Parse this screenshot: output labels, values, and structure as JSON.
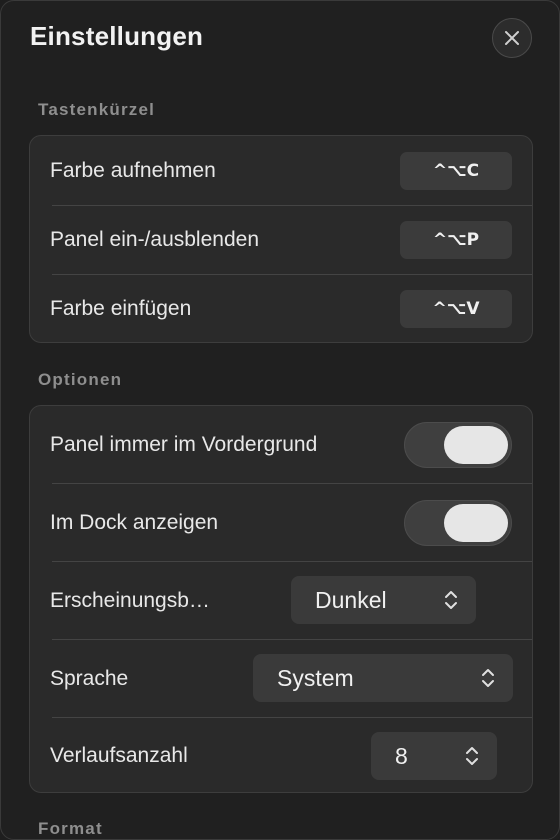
{
  "window": {
    "title": "Einstellungen"
  },
  "sections": {
    "shortcuts": {
      "label": "Tastenkürzel",
      "rows": [
        {
          "label": "Farbe aufnehmen",
          "keys": "^⌥C"
        },
        {
          "label": "Panel ein-/ausblenden",
          "keys": "^⌥P"
        },
        {
          "label": "Farbe einfügen",
          "keys": "^⌥V"
        }
      ]
    },
    "options": {
      "label": "Optionen",
      "rows": [
        {
          "label": "Panel immer im Vordergrund",
          "toggle_on": true
        },
        {
          "label": "Im Dock anzeigen",
          "toggle_on": true
        },
        {
          "label": "Erscheinungsb…",
          "select_value": "Dunkel"
        },
        {
          "label": "Sprache",
          "select_value": "System"
        },
        {
          "label": "Verlaufsanzahl",
          "select_value": "8"
        }
      ]
    },
    "format": {
      "label": "Format"
    }
  },
  "icons": {
    "close": "close-icon",
    "select": "up-down-chevron-icon"
  },
  "colors": {
    "background": "#202020",
    "group_background": "#2a2a2a",
    "control_background": "#3a3a3a",
    "section_label": "#8e8e8e"
  }
}
